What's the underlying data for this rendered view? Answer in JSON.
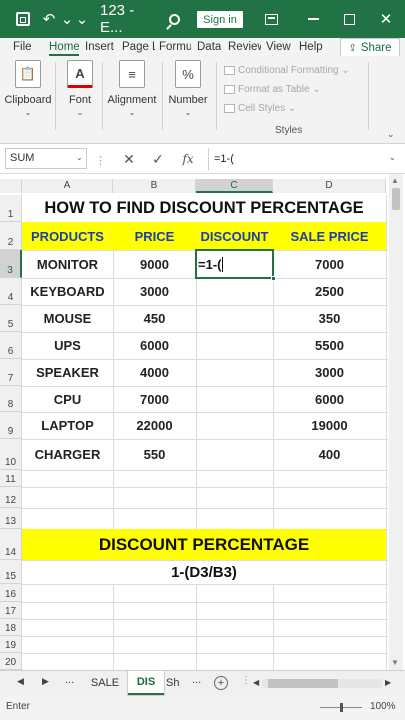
{
  "titlebar": {
    "document_title": "123 - E...",
    "signin_label": "Sign in",
    "close_glyph": "✕",
    "undo_glyph": "↶",
    "dropdown_glyph": "⌄",
    "more_glyph": "⌄"
  },
  "ribbon_tabs": [
    {
      "label": "File"
    },
    {
      "label": "Home"
    },
    {
      "label": "Insert"
    },
    {
      "label": "Page L"
    },
    {
      "label": "Formu"
    },
    {
      "label": "Data"
    },
    {
      "label": "Review"
    },
    {
      "label": "View"
    },
    {
      "label": "Help"
    }
  ],
  "share": {
    "label": "Share",
    "icon": "share-icon"
  },
  "ribbon": {
    "groups": [
      {
        "label": "Clipboard",
        "icon": "clipboard-icon",
        "glyph": "📋"
      },
      {
        "label": "Font",
        "icon": "font-icon",
        "glyph": "A"
      },
      {
        "label": "Alignment",
        "icon": "alignment-icon",
        "glyph": "≡"
      },
      {
        "label": "Number",
        "icon": "percent-icon",
        "glyph": "%"
      }
    ],
    "styles": {
      "conditional_formatting": "Conditional Formatting ⌄",
      "format_as_table": "Format as Table ⌄",
      "cell_styles": "Cell Styles ⌄",
      "group_label": "Styles"
    }
  },
  "formula_bar": {
    "name_box": "SUM",
    "cancel_glyph": "✕",
    "enter_glyph": "✓",
    "fx_label": "fx",
    "formula": "=1-("
  },
  "columns": [
    "A",
    "B",
    "C",
    "D"
  ],
  "rows": [
    "1",
    "2",
    "3",
    "4",
    "5",
    "6",
    "7",
    "8",
    "9",
    "10",
    "11",
    "12",
    "13",
    "14",
    "15",
    "16",
    "17",
    "18",
    "19",
    "20"
  ],
  "sheet": {
    "title": "HOW TO FIND DISCOUNT PERCENTAGE",
    "headers": [
      "PRODUCTS",
      "PRICE",
      "DISCOUNT",
      "SALE PRICE"
    ],
    "data": [
      {
        "product": "MONITOR",
        "price": "9000",
        "discount": "=1-(",
        "sale_price": "7000"
      },
      {
        "product": "KEYBOARD",
        "price": "3000",
        "discount": "",
        "sale_price": "2500"
      },
      {
        "product": "MOUSE",
        "price": "450",
        "discount": "",
        "sale_price": "350"
      },
      {
        "product": "UPS",
        "price": "6000",
        "discount": "",
        "sale_price": "5500"
      },
      {
        "product": "SPEAKER",
        "price": "4000",
        "discount": "",
        "sale_price": "3000"
      },
      {
        "product": "CPU",
        "price": "7000",
        "discount": "",
        "sale_price": "6000"
      },
      {
        "product": "LAPTOP",
        "price": "22000",
        "discount": "",
        "sale_price": "19000"
      },
      {
        "product": "CHARGER",
        "price": "550",
        "discount": "",
        "sale_price": "400"
      }
    ],
    "banner": "DISCOUNT PERCENTAGE",
    "banner_formula": "1-(D3/B3)",
    "highlight_color": "#ffff00",
    "header_text_color": "#1a3fa8"
  },
  "sheet_tabs": {
    "prev_glyph": "◀",
    "next_glyph": "▶",
    "more_left": "...",
    "tabs": [
      {
        "label": "SALE"
      },
      {
        "label": "DIS"
      },
      {
        "label": "Sh"
      }
    ],
    "more_right": "...",
    "add_glyph": "+"
  },
  "status": {
    "mode": "Enter",
    "zoom": "100%"
  },
  "colors": {
    "accent": "#217346"
  }
}
